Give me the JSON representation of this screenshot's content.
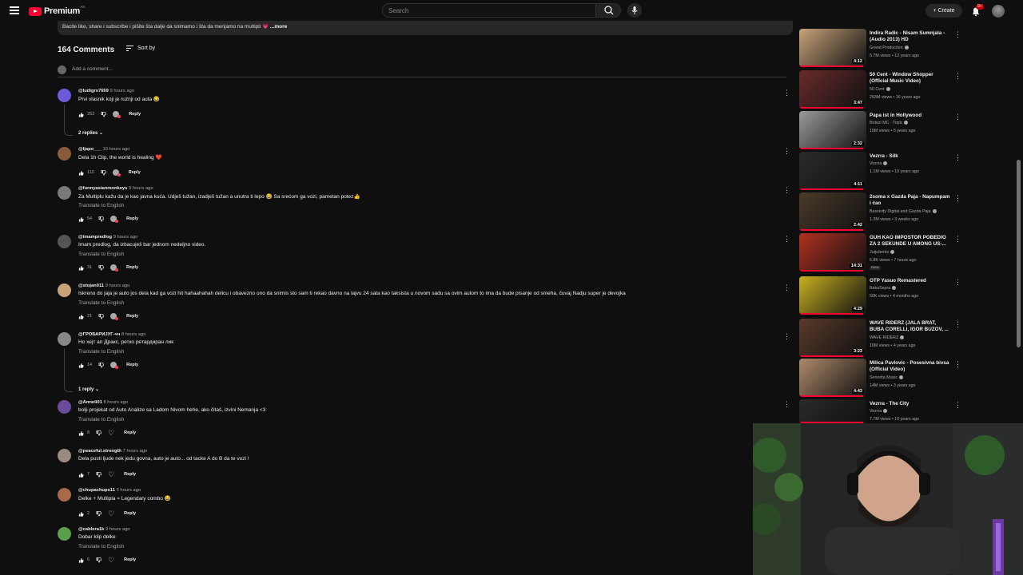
{
  "header": {
    "logo_text": "Premium",
    "logo_sup": "RS",
    "search_placeholder": "Search",
    "create_label": "Create",
    "notifications_badge": "9+"
  },
  "description": {
    "text": "Bacite like, share i subscribe i pišite šta dalje da snimamo i šta da menjamo na multipli 💗",
    "more": "...more"
  },
  "comments_section": {
    "count_label": "164 Comments",
    "sort_label": "Sort by",
    "add_placeholder": "Add a comment..."
  },
  "comments": [
    {
      "author": "@ludigrs7659",
      "time": "9 hours ago",
      "text": "Prvi vlasnik koji je ruznji od auta 😂",
      "translate": "",
      "likes": "253",
      "replies": "2 replies",
      "avatar_color": "#6b5bd6",
      "avatar_letter": "M"
    },
    {
      "author": "@ljapo___",
      "time": "10 hours ago",
      "text": "Dela 1h Clip, the world is healing ❤️",
      "translate": "",
      "likes": "110",
      "replies": "",
      "avatar_color": "#8a5a3c",
      "avatar_letter": ""
    },
    {
      "author": "@funnyasianmonkeys",
      "time": "9 hours ago",
      "text": "Za Multiplu kažu da je kao javna kuća. Udješ tužan, izadješ tužan a unutra ti lepo 😂 Sa srećom ga vozi, pametan potez👍",
      "translate": "Translate to English",
      "likes": "54",
      "replies": "",
      "avatar_color": "#7a7a7a",
      "avatar_letter": ""
    },
    {
      "author": "@imampredlog",
      "time": "9 hours ago",
      "text": "Imam predlog, da izbacuješ bar jednom nedeljno video.",
      "translate": "Translate to English",
      "likes": "31",
      "replies": "",
      "avatar_color": "#555",
      "avatar_letter": ""
    },
    {
      "author": "@stojan011",
      "time": "9 hours ago",
      "text": "Iskreno do jaja je auto jos dela kad ga vozi hit hahaahahah delicu i obavezno ono da snimis sto sam ti rekao davno na lajvu 24 sata kao taksista u novom sadu sa ovim autom to ima da bude pisanje od smeha, čuvaj Nadju super je devojka",
      "translate": "Translate to English",
      "likes": "21",
      "replies": "",
      "avatar_color": "#c9a27a",
      "avatar_letter": ""
    },
    {
      "author": "@ГРОБАРИЈУГ-чч",
      "time": "8 hours ago",
      "text": "Но хејт ап Дракс, ретко ретардиран лик",
      "translate": "Translate to English",
      "likes": "14",
      "replies": "1 reply",
      "avatar_color": "#888",
      "avatar_letter": ""
    },
    {
      "author": "@Anneli01",
      "time": "8 hours ago",
      "text": "bolji projekat od Auto Analize sa Ladom Nivom hehe, ako čitaš, izvini Nemanja <3",
      "translate": "Translate to English",
      "likes": "8",
      "replies": "",
      "avatar_color": "#6a4c9c",
      "avatar_letter": ""
    },
    {
      "author": "@peaceful.strength",
      "time": "7 hours ago",
      "text": "Dela pusti ljude nek jedu govna, auto je auto... od tacke A do B da te vozi !",
      "translate": "",
      "likes": "7",
      "replies": "",
      "avatar_color": "#9a8a80",
      "avatar_letter": ""
    },
    {
      "author": "@chupachups11",
      "time": "5 hours ago",
      "text": "Delke + Multipla = Legendary combo 😂",
      "translate": "",
      "likes": "2",
      "replies": "",
      "avatar_color": "#a86a4a",
      "avatar_letter": ""
    },
    {
      "author": "@cablera1k",
      "time": "9 hours ago",
      "text": "Dobar klip delke",
      "translate": "Translate to English",
      "likes": "6",
      "replies": "",
      "avatar_color": "#5aa04a",
      "avatar_letter": ""
    }
  ],
  "reply_label": "Reply",
  "sidebar_videos": [
    {
      "title": "Indira Radic - Nisam Sumnjala - (Audio 2013) HD",
      "channel": "Grand Production",
      "meta": "5.7M views • 12 years ago",
      "duration": "4:12",
      "progress": 0.95,
      "badge": "",
      "thumb": "#c9a27a"
    },
    {
      "title": "50 Cent - Window Shopper (Official Music Video)",
      "channel": "50 Cent",
      "meta": "293M views • 16 years ago",
      "duration": "3:47",
      "progress": 0.95,
      "badge": "",
      "thumb": "#6a2a2a"
    },
    {
      "title": "Papa ist in Hollywood",
      "channel": "Botezi MC - Topic",
      "meta": "15M views • 5 years ago",
      "duration": "2:32",
      "progress": 0.95,
      "badge": "",
      "thumb": "#9a9a9a"
    },
    {
      "title": "Vezrra - Silk",
      "channel": "Vezrra",
      "meta": "1.1M views • 10 years ago",
      "duration": "4:11",
      "progress": 0.95,
      "badge": "",
      "thumb": "#2a2a2a"
    },
    {
      "title": "2soma x Gazda Paja - Napumpam i ćao",
      "channel": "Bassivity Digital and Gazda Paja",
      "meta": "1.3M views • 3 weeks ago",
      "duration": "2:42",
      "progress": 0.95,
      "badge": "",
      "thumb": "#4a3a2a"
    },
    {
      "title": "GUH KAO IMPOSTOR POBEDIO ZA 2 SEKUNDE U AMONG US-...",
      "channel": "Jutjuberko",
      "meta": "6.8K views • 7 hours ago",
      "duration": "14:31",
      "progress": 0.95,
      "badge": "New",
      "thumb": "#b03020"
    },
    {
      "title": "OTP Yasuo Remastered",
      "channel": "BakaSepra",
      "meta": "50K views • 4 months ago",
      "duration": "4:29",
      "progress": 0.95,
      "badge": "",
      "thumb": "#c8b020"
    },
    {
      "title": "WAVE RIDERZ (JALA BRAT, BUBA CORELLI, IGOR BUZOV, ...",
      "channel": "WAVE RIDERZ",
      "meta": "10M views • 4 years ago",
      "duration": "3:23",
      "progress": 0.95,
      "badge": "",
      "thumb": "#5a3a2a"
    },
    {
      "title": "Milica Pavlovic - Posesivna bivsa (Official Video)",
      "channel": "Senorita Music",
      "meta": "14M views • 3 years ago",
      "duration": "4:43",
      "progress": 0.95,
      "badge": "",
      "thumb": "#b08a6a"
    },
    {
      "title": "Vezrra - The City",
      "channel": "Vezrra",
      "meta": "7.7M views • 10 years ago",
      "duration": "",
      "progress": 0.95,
      "badge": "",
      "thumb": "#2a2a2a"
    }
  ]
}
